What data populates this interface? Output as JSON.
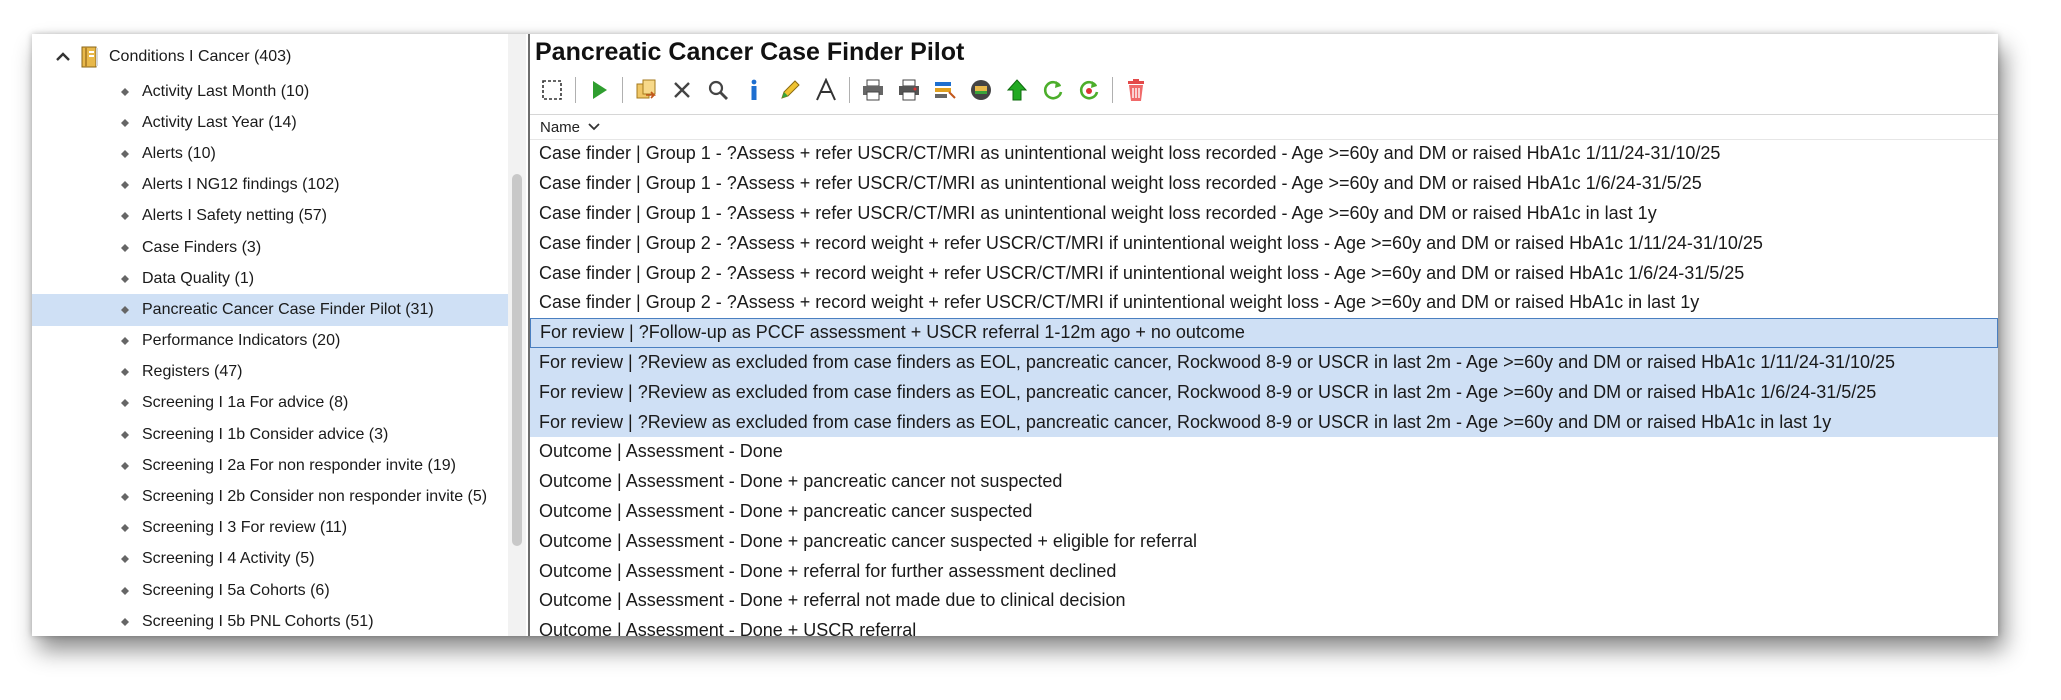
{
  "tree": {
    "root_label": "Conditions I Cancer (403)",
    "items": [
      {
        "label": "Activity Last Month (10)"
      },
      {
        "label": "Activity Last Year (14)"
      },
      {
        "label": "Alerts (10)"
      },
      {
        "label": "Alerts I NG12 findings (102)"
      },
      {
        "label": "Alerts I Safety netting (57)"
      },
      {
        "label": "Case Finders (3)"
      },
      {
        "label": "Data Quality (1)"
      },
      {
        "label": "Pancreatic Cancer Case Finder Pilot (31)",
        "selected": true
      },
      {
        "label": "Performance Indicators (20)"
      },
      {
        "label": "Registers (47)"
      },
      {
        "label": "Screening I 1a For advice (8)"
      },
      {
        "label": "Screening I 1b Consider advice (3)"
      },
      {
        "label": "Screening I 2a For non responder invite (19)"
      },
      {
        "label": "Screening I 2b Consider non responder invite (5)"
      },
      {
        "label": "Screening I 3   For review (11)"
      },
      {
        "label": "Screening I 4   Activity (5)"
      },
      {
        "label": "Screening I 5a Cohorts (6)"
      },
      {
        "label": "Screening I 5b PNL Cohorts (51)"
      }
    ]
  },
  "main": {
    "title": "Pancreatic Cancer Case Finder Pilot",
    "column_header": "Name",
    "rows": [
      {
        "text": "Case finder | Group 1 - ?Assess + refer USCR/CT/MRI as unintentional weight loss recorded - Age >=60y and DM or raised HbA1c 1/11/24-31/10/25"
      },
      {
        "text": "Case finder | Group 1 - ?Assess + refer USCR/CT/MRI as unintentional weight loss recorded - Age >=60y and DM or raised HbA1c 1/6/24-31/5/25"
      },
      {
        "text": "Case finder | Group 1 - ?Assess + refer USCR/CT/MRI as unintentional weight loss recorded - Age >=60y and DM or raised HbA1c in last 1y"
      },
      {
        "text": "Case finder | Group 2 - ?Assess + record weight + refer USCR/CT/MRI if unintentional weight loss - Age >=60y and DM or raised HbA1c 1/11/24-31/10/25"
      },
      {
        "text": "Case finder | Group 2 - ?Assess + record weight + refer USCR/CT/MRI if unintentional weight loss - Age >=60y and DM or raised HbA1c 1/6/24-31/5/25"
      },
      {
        "text": "Case finder | Group 2 - ?Assess + record weight + refer USCR/CT/MRI if unintentional weight loss - Age >=60y and DM or raised HbA1c in last 1y"
      },
      {
        "text": "For review | ?Follow-up as PCCF assessment + USCR referral 1-12m ago + no outcome",
        "selected": true,
        "focused": true
      },
      {
        "text": "For review | ?Review as excluded from case finders as EOL, pancreatic cancer, Rockwood 8-9 or USCR in last 2m - Age >=60y and DM or raised HbA1c 1/11/24-31/10/25",
        "selected": true
      },
      {
        "text": "For review | ?Review as excluded from case finders as EOL, pancreatic cancer, Rockwood 8-9 or USCR in last 2m - Age >=60y and DM or raised HbA1c 1/6/24-31/5/25",
        "selected": true
      },
      {
        "text": "For review | ?Review as excluded from case finders as EOL, pancreatic cancer, Rockwood 8-9 or USCR in last 2m - Age >=60y and DM or raised HbA1c in last 1y",
        "selected": true
      },
      {
        "text": "Outcome | Assessment - Done"
      },
      {
        "text": "Outcome | Assessment - Done + pancreatic cancer not suspected"
      },
      {
        "text": "Outcome | Assessment - Done + pancreatic cancer suspected"
      },
      {
        "text": "Outcome | Assessment - Done + pancreatic cancer suspected + eligible for referral"
      },
      {
        "text": "Outcome | Assessment - Done + referral for further assessment declined"
      },
      {
        "text": "Outcome | Assessment - Done + referral not made due to clinical decision"
      },
      {
        "text": "Outcome | Assessment - Done + USCR referral"
      }
    ]
  },
  "toolbar": {
    "icons": [
      "select-icon",
      "run-icon",
      "copy-icon",
      "delete-icon",
      "search-icon",
      "info-icon",
      "edit-icon",
      "font-icon",
      "print-icon",
      "print-preview-icon",
      "export-icon",
      "report-icon",
      "move-up-icon",
      "refresh-icon",
      "refresh-all-icon",
      "trash-icon"
    ]
  },
  "colors": {
    "selection": "#cfe0f5",
    "focus_border": "#4a7fc0",
    "splitter": "#6d6d6d"
  }
}
